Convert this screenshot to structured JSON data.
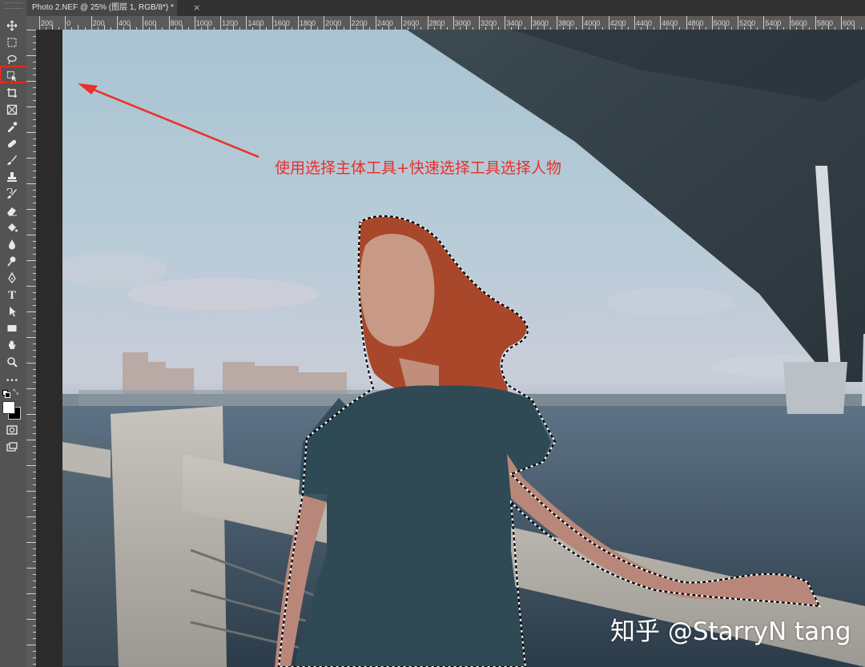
{
  "document_tab": {
    "title": "Photo 2.NEF @ 25% (图层 1, RGB/8*) *",
    "close": "×"
  },
  "ruler_top": [
    "200",
    "0",
    "200",
    "400",
    "600",
    "800",
    "1000",
    "1200",
    "1400",
    "1600",
    "1800",
    "2000",
    "2200",
    "2400",
    "2600",
    "2800",
    "3000",
    "3200",
    "3400",
    "3600",
    "3800",
    "4000",
    "4200",
    "4400",
    "4600",
    "4800",
    "5000",
    "5200",
    "5400",
    "5600",
    "5800",
    "600"
  ],
  "toolbar": {
    "tools": [
      {
        "name": "move-tool",
        "icon": "move-icon"
      },
      {
        "name": "rectangular-marquee-tool",
        "icon": "marquee-icon"
      },
      {
        "name": "lasso-tool",
        "icon": "lasso-icon"
      },
      {
        "name": "object-selection-tool",
        "icon": "object-selection-icon"
      },
      {
        "name": "crop-tool",
        "icon": "crop-icon"
      },
      {
        "name": "frame-tool",
        "icon": "frame-icon"
      },
      {
        "name": "eyedropper-tool",
        "icon": "eyedropper-icon"
      },
      {
        "name": "healing-brush-tool",
        "icon": "bandage-icon"
      },
      {
        "name": "brush-tool",
        "icon": "brush-icon"
      },
      {
        "name": "clone-stamp-tool",
        "icon": "stamp-icon"
      },
      {
        "name": "history-brush-tool",
        "icon": "history-brush-icon"
      },
      {
        "name": "eraser-tool",
        "icon": "eraser-icon"
      },
      {
        "name": "paint-bucket-tool",
        "icon": "bucket-icon"
      },
      {
        "name": "blur-tool",
        "icon": "blur-icon"
      },
      {
        "name": "dodge-tool",
        "icon": "dodge-icon"
      },
      {
        "name": "pen-tool",
        "icon": "pen-icon"
      },
      {
        "name": "type-tool",
        "icon": "type-icon",
        "glyph": "T"
      },
      {
        "name": "path-selection-tool",
        "icon": "path-arrow-icon"
      },
      {
        "name": "rectangle-tool",
        "icon": "rectangle-icon"
      },
      {
        "name": "hand-tool",
        "icon": "hand-icon"
      },
      {
        "name": "zoom-tool",
        "icon": "zoom-icon"
      },
      {
        "name": "edit-toolbar",
        "icon": "more-icon",
        "glyph": "•••"
      }
    ]
  },
  "colors": {
    "foreground": "#ffffff",
    "background": "#000000",
    "annotation": "#e8302a"
  },
  "annotation_text": "使用选择主体工具+快速选择工具选择人物",
  "watermark_text": "知乎 @StarryN tang"
}
